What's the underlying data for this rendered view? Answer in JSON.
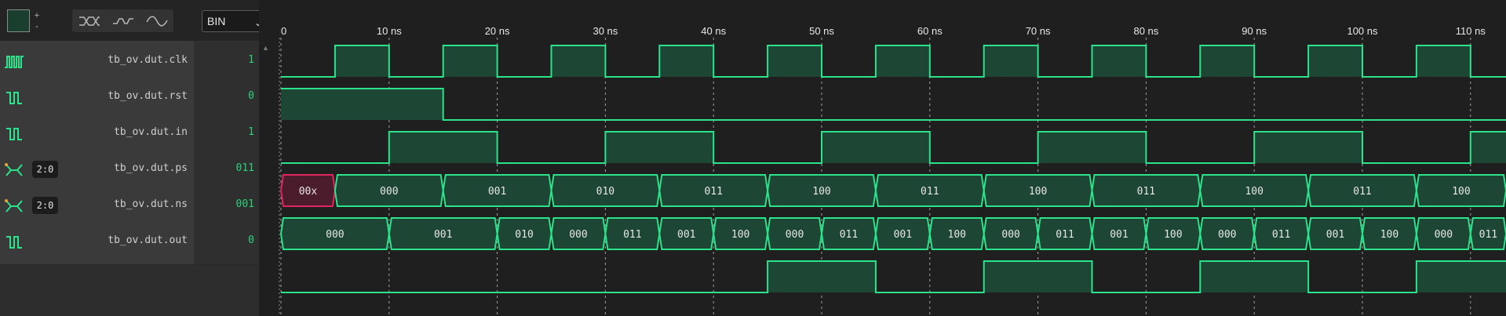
{
  "toolbar": {
    "zoom_in": "+",
    "zoom_out": "-",
    "radix": "BIN",
    "radix_options": [
      "BIN"
    ]
  },
  "timeline": {
    "unit": "ns",
    "ticks": [
      "0",
      "10 ns",
      "20 ns",
      "30 ns",
      "40 ns",
      "50 ns",
      "60 ns",
      "70 ns",
      "80 ns",
      "90 ns",
      "100 ns",
      "110 ns"
    ]
  },
  "signals": [
    {
      "name": "tb_ov.dut.clk",
      "value": "1",
      "kind": "clock",
      "icon": "clock-signal-icon"
    },
    {
      "name": "tb_ov.dut.rst",
      "value": "0",
      "kind": "bit",
      "icon": "bit-signal-icon"
    },
    {
      "name": "tb_ov.dut.in",
      "value": "1",
      "kind": "bit",
      "icon": "bit-signal-icon"
    },
    {
      "name": "tb_ov.dut.ps",
      "value": "011",
      "kind": "bus",
      "width": "2:0",
      "icon": "bus-signal-icon"
    },
    {
      "name": "tb_ov.dut.ns",
      "value": "001",
      "kind": "bus",
      "width": "2:0",
      "icon": "bus-signal-icon"
    },
    {
      "name": "tb_ov.dut.out",
      "value": "0",
      "kind": "bit",
      "icon": "bit-signal-icon"
    }
  ],
  "waveforms": {
    "clk": {
      "period": 10,
      "high_start": 5
    },
    "rst": [
      [
        0,
        1
      ],
      [
        15,
        0
      ]
    ],
    "in": [
      [
        0,
        0
      ],
      [
        10,
        1
      ],
      [
        20,
        0
      ],
      [
        30,
        1
      ],
      [
        40,
        0
      ],
      [
        50,
        1
      ],
      [
        60,
        0
      ],
      [
        70,
        1
      ],
      [
        80,
        0
      ],
      [
        90,
        1
      ],
      [
        100,
        0
      ],
      [
        110,
        1
      ]
    ],
    "ps": [
      {
        "start": 0,
        "end": 5,
        "label": "00x",
        "state": "unknown"
      },
      {
        "start": 5,
        "end": 15,
        "label": "000"
      },
      {
        "start": 15,
        "end": 25,
        "label": "001"
      },
      {
        "start": 25,
        "end": 35,
        "label": "010"
      },
      {
        "start": 35,
        "end": 45,
        "label": "011"
      },
      {
        "start": 45,
        "end": 55,
        "label": "100"
      },
      {
        "start": 55,
        "end": 65,
        "label": "011"
      },
      {
        "start": 65,
        "end": 75,
        "label": "100"
      },
      {
        "start": 75,
        "end": 85,
        "label": "011"
      },
      {
        "start": 85,
        "end": 95,
        "label": "100"
      },
      {
        "start": 95,
        "end": 105,
        "label": "011"
      },
      {
        "start": 105,
        "end": 115,
        "label": "100"
      }
    ],
    "ns": [
      {
        "start": 0,
        "end": 10,
        "label": "000"
      },
      {
        "start": 10,
        "end": 20,
        "label": "001"
      },
      {
        "start": 20,
        "end": 25,
        "label": "010"
      },
      {
        "start": 25,
        "end": 30,
        "label": "000"
      },
      {
        "start": 30,
        "end": 35,
        "label": "011"
      },
      {
        "start": 35,
        "end": 40,
        "label": "001"
      },
      {
        "start": 40,
        "end": 45,
        "label": "100"
      },
      {
        "start": 45,
        "end": 50,
        "label": "000"
      },
      {
        "start": 50,
        "end": 55,
        "label": "011"
      },
      {
        "start": 55,
        "end": 60,
        "label": "001"
      },
      {
        "start": 60,
        "end": 65,
        "label": "100"
      },
      {
        "start": 65,
        "end": 70,
        "label": "000"
      },
      {
        "start": 70,
        "end": 75,
        "label": "011"
      },
      {
        "start": 75,
        "end": 80,
        "label": "001"
      },
      {
        "start": 80,
        "end": 85,
        "label": "100"
      },
      {
        "start": 85,
        "end": 90,
        "label": "000"
      },
      {
        "start": 90,
        "end": 95,
        "label": "011"
      },
      {
        "start": 95,
        "end": 100,
        "label": "001"
      },
      {
        "start": 100,
        "end": 105,
        "label": "100"
      },
      {
        "start": 105,
        "end": 110,
        "label": "000"
      },
      {
        "start": 110,
        "end": 115,
        "label": "011"
      }
    ],
    "out": [
      [
        0,
        0
      ],
      [
        45,
        1
      ],
      [
        55,
        0
      ],
      [
        65,
        1
      ],
      [
        75,
        0
      ],
      [
        85,
        1
      ],
      [
        95,
        0
      ],
      [
        105,
        1
      ]
    ]
  },
  "colors": {
    "wave": "#2be38a",
    "wave_fill": "#1d4634",
    "unknown_fill": "#4a1c2c",
    "unknown_stroke": "#e0255f",
    "grid": "#d8d8d8",
    "value_text": "#2ad27a"
  }
}
